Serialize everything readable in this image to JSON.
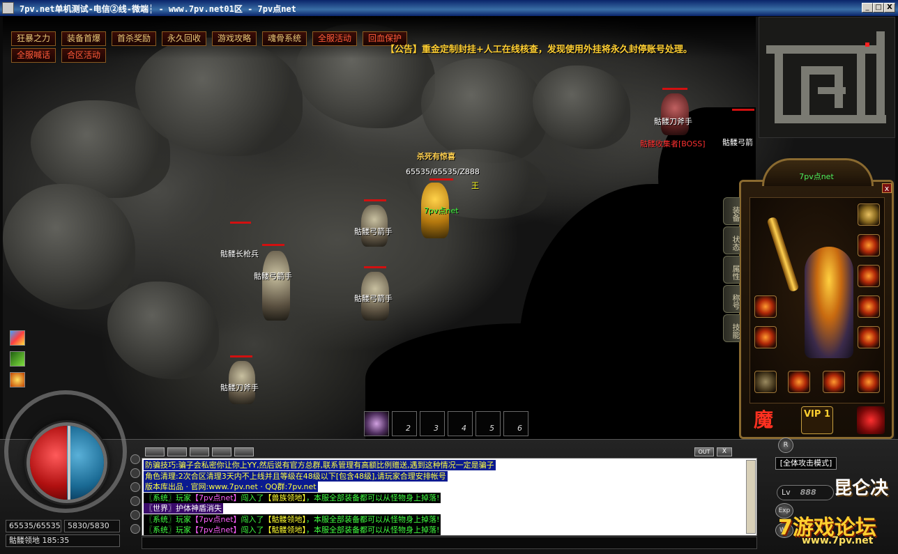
{
  "window": {
    "title": "7pv.net单机测试-电信②线-微端┆ - www.7pv.net01区 - 7pv点net",
    "minimize": "_",
    "maximize": "□",
    "close": "X"
  },
  "top_menu": [
    {
      "label": "狂暴之力",
      "color": "#e8c878"
    },
    {
      "label": "装备首爆",
      "color": "#e8c878"
    },
    {
      "label": "首杀奖励",
      "color": "#e8c878"
    },
    {
      "label": "永久回收",
      "color": "#e8c878"
    },
    {
      "label": "游戏攻略",
      "color": "#e8c878"
    },
    {
      "label": "魂骨系统",
      "color": "#e8c878"
    },
    {
      "label": "全服活动",
      "color": "#ff5a3a"
    },
    {
      "label": "回血保护",
      "color": "#ff5a3a"
    },
    {
      "label": "全服喊话",
      "color": "#ff5a3a"
    },
    {
      "label": "合区活动",
      "color": "#ff5a3a"
    }
  ],
  "notice": "【公告】重金定制封挂+人工在线核查，发现使用外挂将永久封停账号处理。",
  "player": {
    "title": "杀死有惊喜",
    "stats": "65535/65535/Z888",
    "name": "7pv点net",
    "guild_mark": "王"
  },
  "monsters": [
    {
      "name": "骷髅刀斧手",
      "type": "normal"
    },
    {
      "name": "骷髅收集者[BOSS]",
      "type": "boss"
    },
    {
      "name": "骷髅弓箭",
      "type": "normal"
    },
    {
      "name": "骷髅弓箭手",
      "type": "normal"
    },
    {
      "name": "骷髅长枪兵",
      "type": "normal"
    },
    {
      "name": "骷髅弓箭手",
      "type": "normal"
    },
    {
      "name": "骷髅弓箭手",
      "type": "normal"
    },
    {
      "name": "骷髅刀斧手",
      "type": "normal"
    }
  ],
  "char_panel": {
    "site": "7pv点net",
    "close": "x",
    "tabs": [
      "装备",
      "状态",
      "属性",
      "称号",
      "技能"
    ],
    "bottom": {
      "left": "魔",
      "vip": "VIP 1"
    }
  },
  "skillbar": [
    "",
    "2",
    "3",
    "4",
    "5",
    "6"
  ],
  "hud": {
    "hp": "65535/65535",
    "mp": "5830/5830",
    "location": "骷髅领地  185:35",
    "hp_fraction": 1.0,
    "mp_fraction": 1.0,
    "attack_mode": "[全体攻击模式]",
    "lv_label": "Lv",
    "level": "888",
    "brand": "昆仑决"
  },
  "chat": {
    "out": "OUT",
    "close": "X",
    "lines": [
      {
        "style": "sel",
        "segments": [
          {
            "text": "防骗技巧:骗子会私密你让你上YY,然后说有官方总群,联系管理有高额比例赠送,遇到这种情况一定是骗子",
            "c": ""
          }
        ]
      },
      {
        "style": "sel",
        "segments": [
          {
            "text": "角色清理:2次合区清理3天内不上线并且等级在48级以下[包含48级],请玩家合理安排帐号",
            "c": ""
          }
        ]
      },
      {
        "style": "sel",
        "segments": [
          {
            "text": "版本库出品 · 官网:www.7pv.net · QQ群:7pv.net",
            "c": ""
          }
        ]
      },
      {
        "style": "green",
        "segments": [
          {
            "text": "〖系统〗玩家",
            "c": ""
          },
          {
            "text": "【7pv点net】",
            "c": "p"
          },
          {
            "text": "闯入了",
            "c": ""
          },
          {
            "text": "【兽族领地】",
            "c": "y"
          },
          {
            "text": "，本服全部装备都可以从怪物身上掉落!",
            "c": ""
          }
        ]
      },
      {
        "style": "purple",
        "segments": [
          {
            "text": "〖世界〗护体神盾消失",
            "c": ""
          }
        ]
      },
      {
        "style": "green",
        "segments": [
          {
            "text": "〖系统〗玩家",
            "c": ""
          },
          {
            "text": "【7pv点net】",
            "c": "p"
          },
          {
            "text": "闯入了",
            "c": ""
          },
          {
            "text": "【骷髅领地】",
            "c": "y"
          },
          {
            "text": "，本服全部装备都可以从怪物身上掉落!",
            "c": ""
          }
        ]
      },
      {
        "style": "green",
        "segments": [
          {
            "text": "〖系统〗玩家",
            "c": ""
          },
          {
            "text": "【7pv点net】",
            "c": "p"
          },
          {
            "text": "闯入了",
            "c": ""
          },
          {
            "text": "【骷髅领地】",
            "c": "y"
          },
          {
            "text": "，本服全部装备都可以从怪物身上掉落!",
            "c": ""
          }
        ]
      }
    ]
  },
  "watermark": {
    "big": "7游戏论坛",
    "url": "www.7pv.net"
  },
  "right_buttons": [
    "R",
    "Exp",
    "We"
  ],
  "icons": [
    "cube-icon",
    "grass-skill-icon",
    "exp-icon",
    "potion-icon",
    "gear-chest-icon"
  ]
}
